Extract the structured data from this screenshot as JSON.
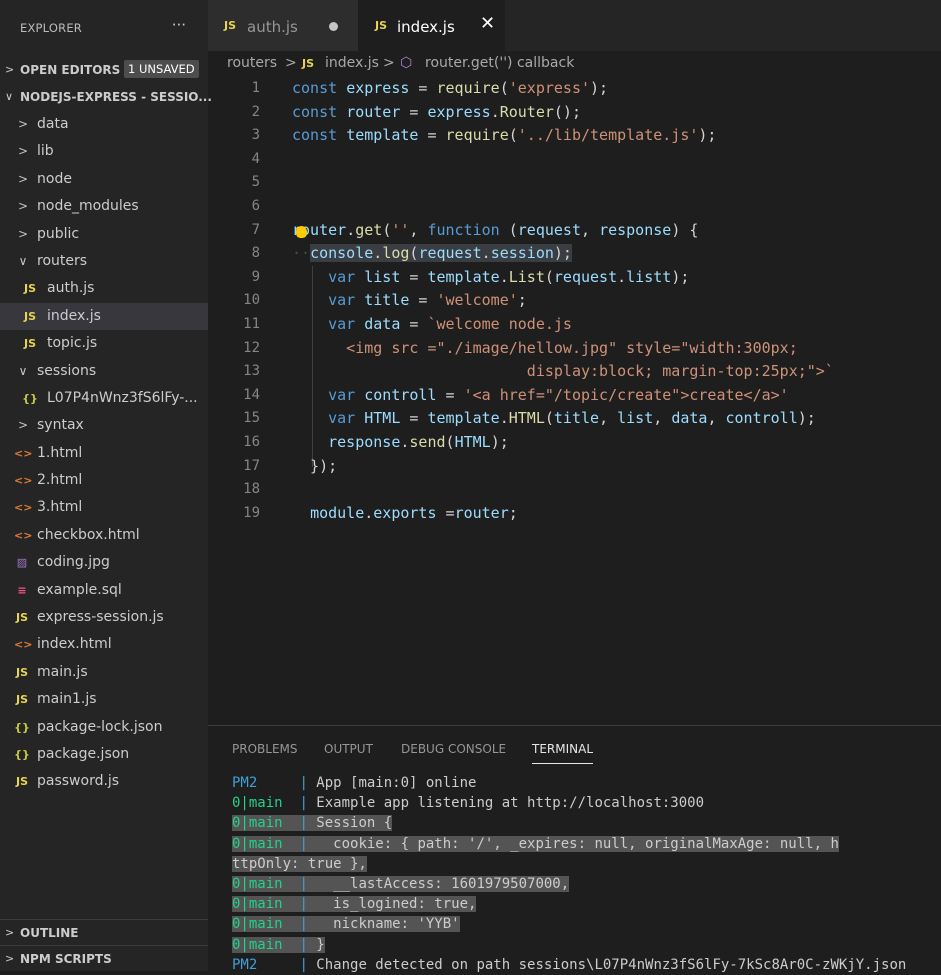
{
  "explorer": {
    "title": "EXPLORER",
    "more": "···",
    "open_editors": {
      "label": "OPEN EDITORS",
      "badge": "1 UNSAVED"
    },
    "folder": {
      "label": "NODEJS-EXPRESS - SESSIO..."
    },
    "tree": [
      {
        "label": "data",
        "kind": "folder",
        "expanded": false
      },
      {
        "label": "lib",
        "kind": "folder",
        "expanded": false
      },
      {
        "label": "node",
        "kind": "folder",
        "expanded": false
      },
      {
        "label": "node_modules",
        "kind": "folder",
        "expanded": false
      },
      {
        "label": "public",
        "kind": "folder",
        "expanded": false
      },
      {
        "label": "routers",
        "kind": "folder",
        "expanded": true
      },
      {
        "label": "auth.js",
        "kind": "js"
      },
      {
        "label": "index.js",
        "kind": "js",
        "selected": true
      },
      {
        "label": "topic.js",
        "kind": "js"
      },
      {
        "label": "sessions",
        "kind": "folder",
        "expanded": true
      },
      {
        "label": "L07P4nWnz3fS6lFy-...",
        "kind": "json"
      },
      {
        "label": "syntax",
        "kind": "folder",
        "expanded": false
      },
      {
        "label": "1.html",
        "kind": "html"
      },
      {
        "label": "2.html",
        "kind": "html"
      },
      {
        "label": "3.html",
        "kind": "html"
      },
      {
        "label": "checkbox.html",
        "kind": "html"
      },
      {
        "label": "coding.jpg",
        "kind": "image"
      },
      {
        "label": "example.sql",
        "kind": "sql"
      },
      {
        "label": "express-session.js",
        "kind": "js"
      },
      {
        "label": "index.html",
        "kind": "html"
      },
      {
        "label": "main.js",
        "kind": "js"
      },
      {
        "label": "main1.js",
        "kind": "js"
      },
      {
        "label": "package-lock.json",
        "kind": "json"
      },
      {
        "label": "package.json",
        "kind": "json"
      },
      {
        "label": "password.js",
        "kind": "js"
      }
    ],
    "outline": "OUTLINE",
    "npm_scripts": "NPM SCRIPTS"
  },
  "icons": {
    "js": "JS",
    "html": "<>",
    "json": "{}",
    "folder_open": "∨",
    "folder_closed": ">",
    "close": "✕"
  },
  "tabs": [
    {
      "label": "auth.js",
      "unsaved": true,
      "active": false
    },
    {
      "label": "index.js",
      "unsaved": false,
      "active": true
    }
  ],
  "breadcrumb": {
    "folder": "routers",
    "sep": ">",
    "file": "index.js",
    "symbol": "router.get('') callback"
  },
  "editor": {
    "lines": [
      {
        "num": "1",
        "text": "const express = require('express');"
      },
      {
        "num": "2",
        "text": "const router = express.Router();"
      },
      {
        "num": "3",
        "text": "const template = require('../lib/template.js');"
      },
      {
        "num": "4",
        "text": ""
      },
      {
        "num": "5",
        "text": ""
      },
      {
        "num": "6",
        "text": ""
      },
      {
        "num": "7",
        "text": "router.get('', function (request, response) {"
      },
      {
        "num": "8",
        "text": "  console.log(request.session);"
      },
      {
        "num": "9",
        "text": "    var list = template.List(request.listt);"
      },
      {
        "num": "10",
        "text": "    var title = 'welcome';"
      },
      {
        "num": "11",
        "text": "    var data = `welcome node.js"
      },
      {
        "num": "12",
        "text": "      <img src =\"./image/hellow.jpg\" style=\"width:300px;"
      },
      {
        "num": "13",
        "text": "                          display:block; margin-top:25px;\">`"
      },
      {
        "num": "14",
        "text": "    var controll = '<a href=\"/topic/create\">create</a>'"
      },
      {
        "num": "15",
        "text": "    var HTML = template.HTML(title, list, data, controll);"
      },
      {
        "num": "16",
        "text": "    response.send(HTML);"
      },
      {
        "num": "17",
        "text": "  });"
      },
      {
        "num": "18",
        "text": ""
      },
      {
        "num": "19",
        "text": "  module.exports =router;"
      }
    ]
  },
  "panel": {
    "tabs": [
      "PROBLEMS",
      "OUTPUT",
      "DEBUG CONSOLE",
      "TERMINAL"
    ],
    "active_tab": "TERMINAL",
    "terminal": [
      {
        "prefix": "PM2     ",
        "bar": "| ",
        "text": "App [main:0] online"
      },
      {
        "prefix": "0|main  ",
        "bar": "| ",
        "text": "Example app listening at http://localhost:3000"
      },
      {
        "prefix": "0|main  ",
        "bar": "| ",
        "text": "Session {"
      },
      {
        "prefix": "0|main  ",
        "bar": "| ",
        "text": "  cookie: { path: '/', _expires: null, originalMaxAge: null, h"
      },
      {
        "prefix": "",
        "bar": "",
        "text": "ttpOnly: true },"
      },
      {
        "prefix": "0|main  ",
        "bar": "| ",
        "text": "  __lastAccess: 1601979507000,"
      },
      {
        "prefix": "0|main  ",
        "bar": "| ",
        "text": "  is_logined: true,"
      },
      {
        "prefix": "0|main  ",
        "bar": "| ",
        "text": "  nickname: 'YYB'"
      },
      {
        "prefix": "0|main  ",
        "bar": "| ",
        "text": "}"
      },
      {
        "prefix": "PM2     ",
        "bar": "| ",
        "text": "Change detected on path sessions\\L07P4nWnz3fS6lFy-7kSc8Ar0C-zWKjY.json"
      }
    ]
  },
  "colors": {
    "accent": "#007acc",
    "terminal_main": "#23d18b",
    "terminal_pm2": "#3ea0d6",
    "js_icon": "#e8d44d",
    "html_icon": "#e37933"
  }
}
